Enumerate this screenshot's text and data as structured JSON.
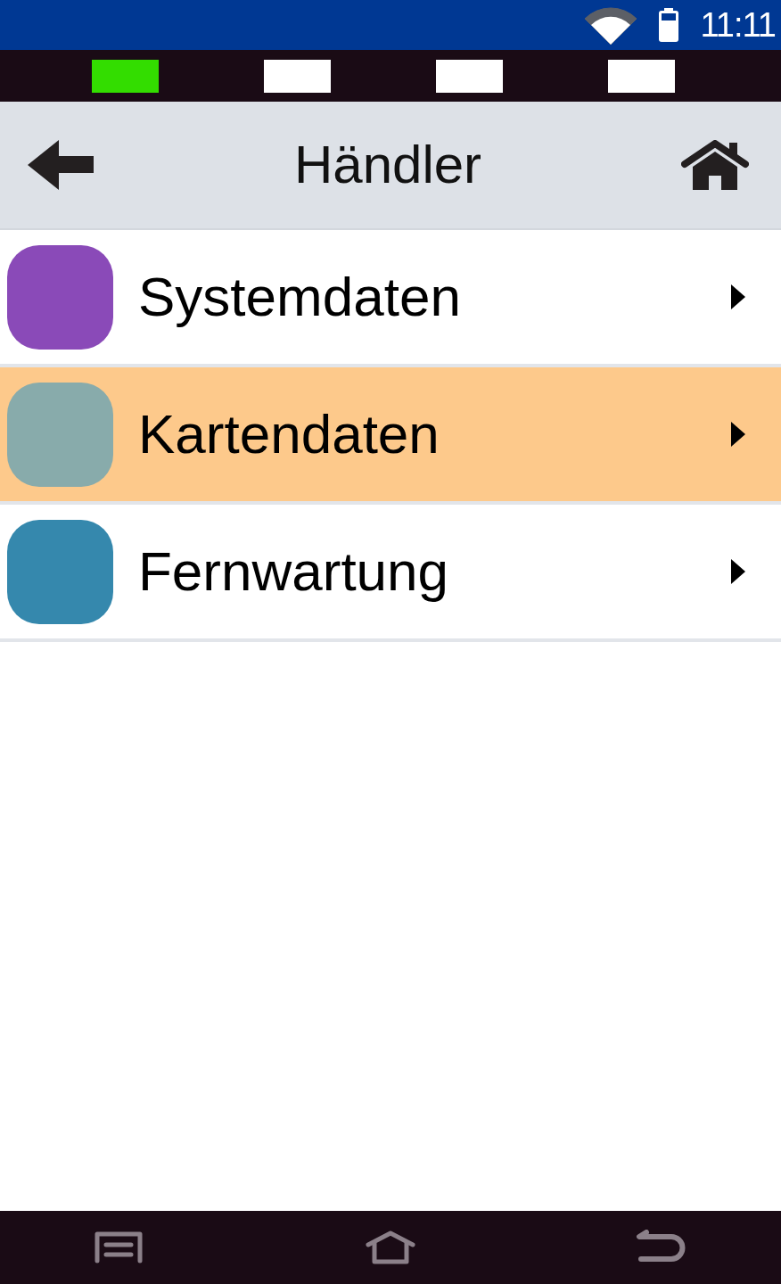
{
  "status_bar": {
    "time": "11:11"
  },
  "indicator_lights": [
    {
      "on": true
    },
    {
      "on": false
    },
    {
      "on": false
    },
    {
      "on": false
    }
  ],
  "header": {
    "title": "Händler"
  },
  "menu": {
    "items": [
      {
        "label": "Systemdaten",
        "color": "#8a4ab8",
        "selected": false
      },
      {
        "label": "Kartendaten",
        "color": "#88abab",
        "selected": true
      },
      {
        "label": "Fernwartung",
        "color": "#3588ad",
        "selected": false
      }
    ]
  }
}
